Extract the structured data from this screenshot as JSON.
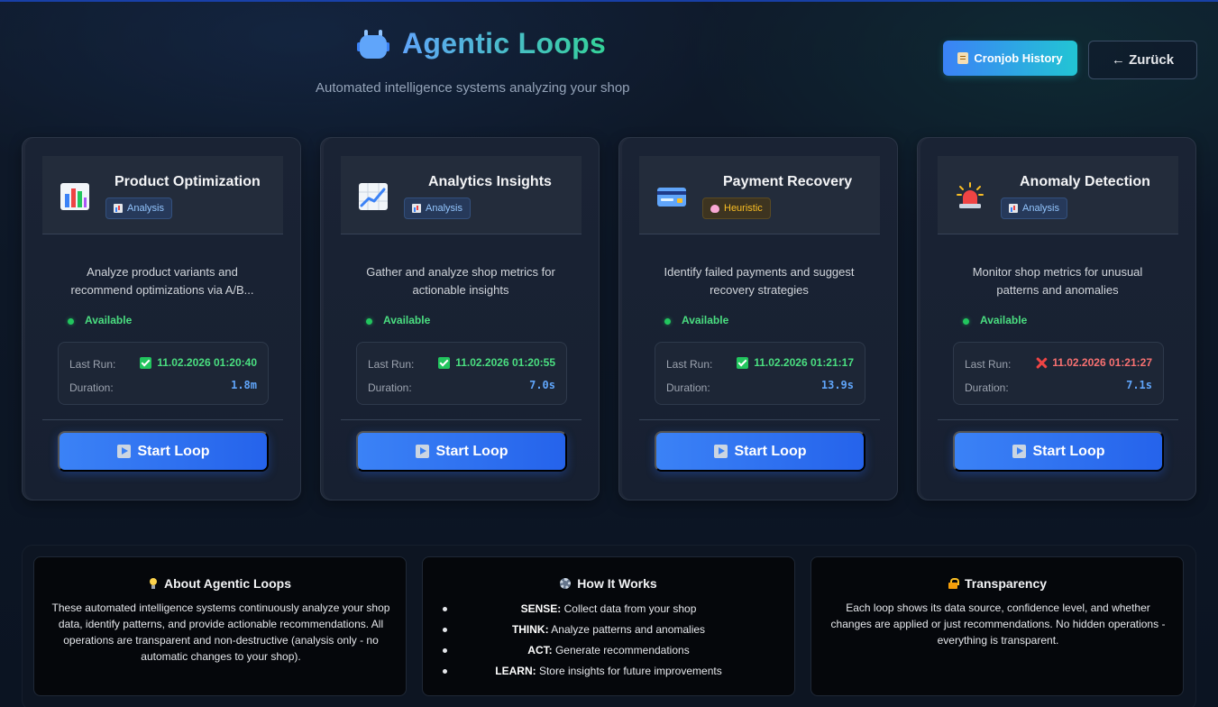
{
  "header": {
    "title": "Agentic Loops",
    "subtitle": "Automated intelligence systems analyzing your shop",
    "title_icon": "robot-icon",
    "cron_button_label": "Cronjob History",
    "back_button_label": "← Zurück"
  },
  "labels": {
    "last_run": "Last Run:",
    "duration": "Duration:",
    "start_loop": "Start Loop"
  },
  "loops": [
    {
      "title": "Product Optimization",
      "icon": "bar-chart-icon",
      "badge": "Analysis",
      "badge_type": "analysis",
      "description": "Analyze product variants and recommend optimizations via A/B...",
      "status": "Available",
      "last_run": "11.02.2026 01:20:40",
      "last_run_ok": true,
      "duration": "1.8m"
    },
    {
      "title": "Analytics Insights",
      "icon": "trend-chart-icon",
      "badge": "Analysis",
      "badge_type": "analysis",
      "description": "Gather and analyze shop metrics for actionable insights",
      "status": "Available",
      "last_run": "11.02.2026 01:20:55",
      "last_run_ok": true,
      "duration": "7.0s"
    },
    {
      "title": "Payment Recovery",
      "icon": "credit-card-icon",
      "badge": "Heuristic",
      "badge_type": "heuristic",
      "description": "Identify failed payments and suggest recovery strategies",
      "status": "Available",
      "last_run": "11.02.2026 01:21:17",
      "last_run_ok": true,
      "duration": "13.9s"
    },
    {
      "title": "Anomaly Detection",
      "icon": "siren-icon",
      "badge": "Analysis",
      "badge_type": "analysis",
      "description": "Monitor shop metrics for unusual patterns and anomalies",
      "status": "Available",
      "last_run": "11.02.2026 01:21:27",
      "last_run_ok": false,
      "duration": "7.1s"
    }
  ],
  "info": {
    "about": {
      "title": "About Agentic Loops",
      "text": "These automated intelligence systems continuously analyze your shop data, identify patterns, and provide actionable recommendations. All operations are transparent and non-destructive (analysis only - no automatic changes to your shop)."
    },
    "how": {
      "title": "How It Works",
      "items": [
        {
          "term": "SENSE:",
          "text": " Collect data from your shop"
        },
        {
          "term": "THINK:",
          "text": " Analyze patterns and anomalies"
        },
        {
          "term": "ACT:",
          "text": " Generate recommendations"
        },
        {
          "term": "LEARN:",
          "text": " Store insights for future improvements"
        }
      ]
    },
    "transparency": {
      "title": "Transparency",
      "text": "Each loop shows its data source, confidence level, and whether changes are applied or just recommendations. No hidden operations - everything is transparent."
    }
  },
  "colors": {
    "accent": "#3b82f6",
    "title_gradient_start": "#60a5fa",
    "title_gradient_end": "#34d399",
    "success": "#4ade80",
    "error": "#f87171"
  }
}
